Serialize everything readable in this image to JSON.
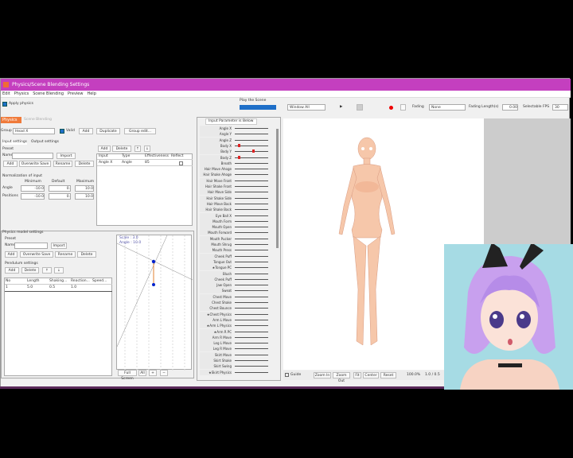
{
  "window": {
    "title": "Physics/Scene Blending Settings"
  },
  "menu": [
    "Edit",
    "Physics",
    "Scene Blending",
    "Preview",
    "Help"
  ],
  "toolbar": {
    "apply_physics": "Apply physics",
    "play_scene_label": "Play the Scene",
    "scene_select": "",
    "window_select": "Window All",
    "fading_label": "Fading",
    "fading_value": "None",
    "fading_length_label": "Fading Length(s)",
    "fading_length_value": "0.00",
    "selectable_fps_label": "Selectable FPS",
    "fps_value": "30"
  },
  "tabs": {
    "physics": "Physics",
    "scene_blending": "Scene Blending"
  },
  "group": {
    "label": "Group",
    "value": "Head X",
    "valid": "Valid",
    "add": "Add",
    "duplicate": "Duplicate",
    "group_edit": "Group edit..."
  },
  "input_tabs": [
    "Input settings",
    "Output settings"
  ],
  "input": {
    "preset_label": "Preset",
    "name_label": "Name",
    "import": "Import",
    "add": "Add",
    "overwrite": "Overwrite Save",
    "rename": "Rename",
    "delete": "Delete",
    "btn_add": "Add",
    "btn_delete": "Delete",
    "up": "↑",
    "down": "↓",
    "columns": [
      "Input",
      "Type",
      "Effectiveness",
      "Reflect"
    ],
    "rows": [
      [
        "Angle X",
        "Angle",
        "85",
        ""
      ]
    ]
  },
  "normalization": {
    "title": "Normalization of input",
    "headers": [
      "Minimum",
      "Default",
      "Maximum"
    ],
    "rows": [
      {
        "label": "Angle",
        "min": "-10.0",
        "def": "0.",
        "max": "10.0"
      },
      {
        "label": "Positions",
        "min": "-10.0",
        "def": "0.",
        "max": "10.0"
      }
    ]
  },
  "pendulum": {
    "title": "Physics model settings",
    "preset_label": "Preset",
    "name_label": "Name",
    "import": "Import",
    "add": "Add",
    "overwrite": "Overwrite Save",
    "rename": "Rename",
    "delete": "Delete",
    "settings_title": "Pendulum settings",
    "p_add": "Add",
    "p_delete": "Delete",
    "up": "↑",
    "down": "↓",
    "columns": [
      "No",
      "Length",
      "Shaking...",
      "Reaction...",
      "Speed..."
    ],
    "rows": [
      [
        "1",
        "5.0",
        "0.5",
        "1.0",
        ""
      ]
    ]
  },
  "preview": {
    "scale_text": "Scale : 3.0",
    "angle_text": "Angle : 10.0",
    "full_screen": "Full Screen",
    "all": "All"
  },
  "param_panel": {
    "title": "Input Parameter is Below",
    "params": [
      "Angle X",
      "Angle Y",
      "Angle Z",
      "Body X",
      "Body Y",
      "Body Z",
      "Breath",
      "Hair Move Ahoge",
      "Hair Shake Ahoge",
      "Hair Move Front",
      "Hair Shake Front",
      "Hair Move Side",
      "Hair Shake Side",
      "Hair Move Back",
      "Hair Shake Back",
      "Eye Ball X",
      "Mouth Form",
      "Mouth Open",
      "Mouth Forward",
      "Mouth Pucker",
      "Mouth Shrug",
      "Mouth Press",
      "Cheek Puff",
      "Tongue Out",
      "★Tongue PC",
      "Blush",
      "Cheek Puff",
      "Jaw Open",
      "Sweat",
      "Chest Move",
      "Chest Shake",
      "Chest Bounce",
      "★Chest Physics",
      "Arm L Move",
      "★Arm L Physics",
      "★Arm R PC",
      "Arm R Move",
      "Leg L Move",
      "Leg R Move",
      "Skirt Move",
      "Skirt Shake",
      "Skirt Swing",
      "★Skirt Physics"
    ]
  },
  "bottom": {
    "guide": "Guide",
    "zoom_in": "Zoom In",
    "zoom_out": "Zoom Out",
    "fit": "Fit",
    "center": "Center",
    "reset": "Reset",
    "zoom_value": "100.0%",
    "coords": "1.0 / 0.5"
  }
}
